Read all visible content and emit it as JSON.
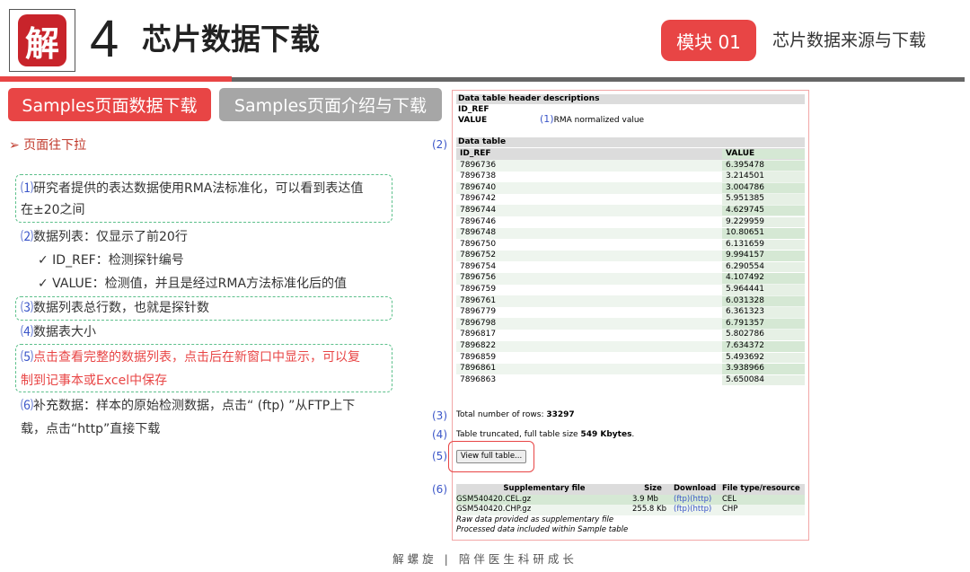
{
  "header": {
    "logo_char": "解",
    "big_number": "4",
    "title": "芯片数据下载",
    "module_badge": "模块 01",
    "module_subtitle": "芯片数据来源与下载"
  },
  "tabs": [
    "Samples页面数据下载",
    "Samples页面介绍与下载"
  ],
  "scroll_note": "➢ 页面往下拉",
  "notes": {
    "n1_num": "⑴",
    "n1_line1": "研究者提供的表达数据使用RMA法标准化，可以看到表达值",
    "n1_line2": "在±20之间",
    "n2_num": "⑵",
    "n2_text": "数据列表：仅显示了前20行",
    "n2_sub1": "✓ ID_REF：检测探针编号",
    "n2_sub2": "✓ VALUE：检测值，并且是经过RMA方法标准化后的值",
    "n3_num": "⑶",
    "n3_text": "数据列表总行数，也就是探针数",
    "n4_num": "⑷",
    "n4_text": "数据表大小",
    "n5_num": "⑸",
    "n5_line1": "点击查看完整的数据列表，点击后在新窗口中显示，可以复",
    "n5_line2": "制到记事本或Excel中保存",
    "n6_num": "⑹",
    "n6_line1": "补充数据：样本的原始检测数据，点击“ (ftp) ”从FTP上下",
    "n6_line2": "载，点击“http”直接下载"
  },
  "geo": {
    "header_desc_title": "Data table header descriptions",
    "id_ref_label": "ID_REF",
    "value_label": "VALUE",
    "value_desc": "RMA normalized value",
    "marker1": "(1)",
    "marker2": "(2)",
    "marker3": "(3)",
    "marker4": "(4)",
    "marker5": "(5)",
    "marker6": "(6)",
    "data_table_title": "Data table",
    "col_id": "ID_REF",
    "col_value": "VALUE",
    "rows": [
      [
        "7896736",
        "6.395478"
      ],
      [
        "7896738",
        "3.214501"
      ],
      [
        "7896740",
        "3.004786"
      ],
      [
        "7896742",
        "5.951385"
      ],
      [
        "7896744",
        "4.629745"
      ],
      [
        "7896746",
        "9.229959"
      ],
      [
        "7896748",
        "10.80651"
      ],
      [
        "7896750",
        "6.131659"
      ],
      [
        "7896752",
        "9.994157"
      ],
      [
        "7896754",
        "6.290554"
      ],
      [
        "7896756",
        "4.107492"
      ],
      [
        "7896759",
        "5.964441"
      ],
      [
        "7896761",
        "6.031328"
      ],
      [
        "7896779",
        "6.361323"
      ],
      [
        "7896798",
        "6.791357"
      ],
      [
        "7896817",
        "5.802786"
      ],
      [
        "7896822",
        "7.634372"
      ],
      [
        "7896859",
        "5.493692"
      ],
      [
        "7896861",
        "3.938966"
      ],
      [
        "7896863",
        "5.650084"
      ]
    ],
    "total_rows_label": "Total number of rows:",
    "total_rows_value": "33297",
    "truncated_label": "Table truncated, full table size",
    "truncated_value": "549 Kbytes",
    "view_full_button": "View full table...",
    "supp_headers": [
      "Supplementary file",
      "Size",
      "Download",
      "File type/resource"
    ],
    "supp_rows": [
      {
        "file": "GSM540420.CEL.gz",
        "size": "3.9 Mb",
        "download": "(ftp)(http)",
        "type": "CEL"
      },
      {
        "file": "GSM540420.CHP.gz",
        "size": "255.8 Kb",
        "download": "(ftp)(http)",
        "type": "CHP"
      }
    ],
    "supp_note1": "Raw data provided as supplementary file",
    "supp_note2": "Processed data included within Sample table"
  },
  "footer": "解螺旋  |  陪伴医生科研成长",
  "colors": {
    "accent": "#e84545",
    "marker": "#3a55c8",
    "dashed_box": "#5cc08b"
  }
}
